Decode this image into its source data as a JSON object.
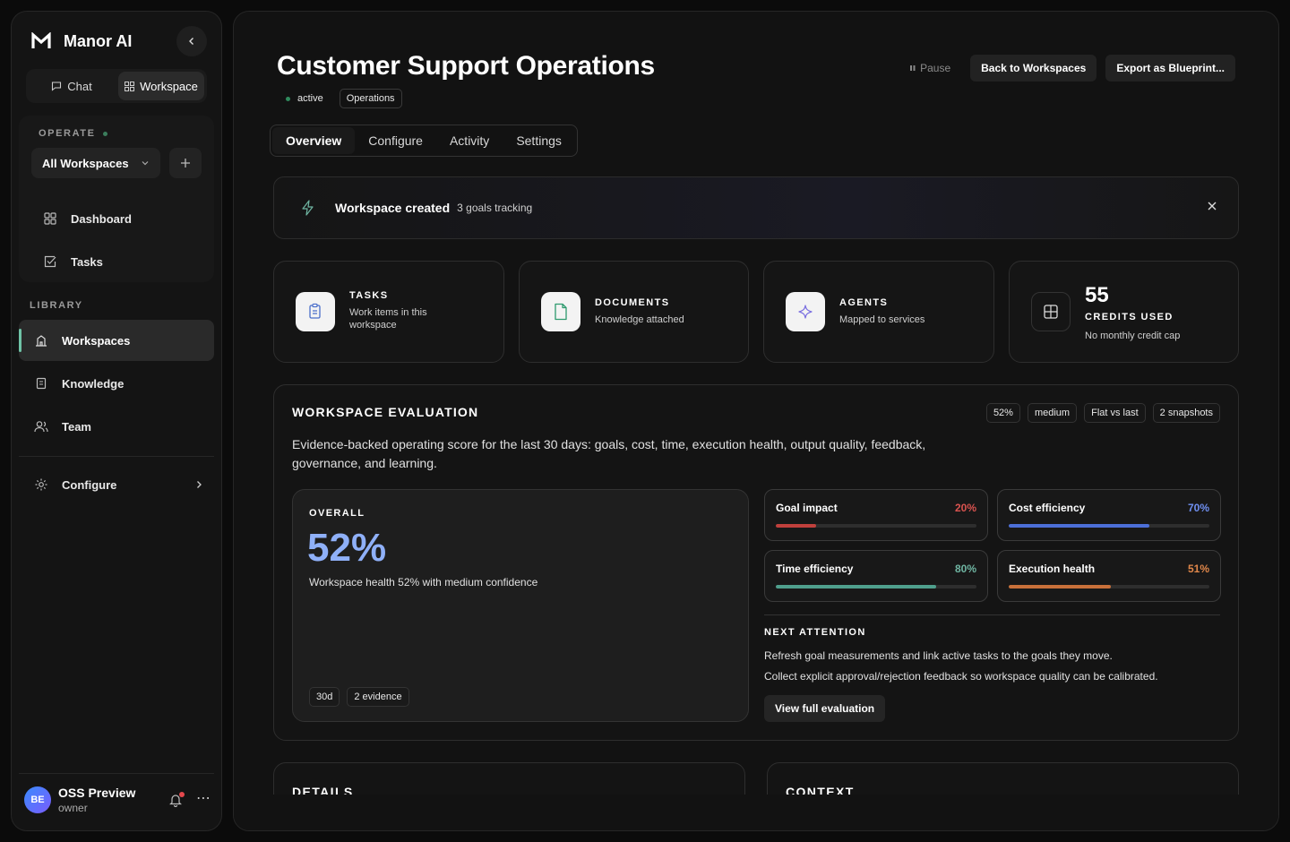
{
  "brand": {
    "name": "Manor AI"
  },
  "mode_switch": {
    "chat": "Chat",
    "workspace": "Workspace"
  },
  "sidebar": {
    "operate_label": "OPERATE",
    "workspace_select": "All Workspaces",
    "operate_items": [
      {
        "label": "Dashboard",
        "icon": "grid-icon"
      },
      {
        "label": "Tasks",
        "icon": "checkbox-icon"
      }
    ],
    "library_label": "LIBRARY",
    "library_items": [
      {
        "label": "Workspaces",
        "icon": "building-icon",
        "active": true
      },
      {
        "label": "Knowledge",
        "icon": "book-icon"
      },
      {
        "label": "Team",
        "icon": "users-icon"
      }
    ],
    "configure": "Configure"
  },
  "user": {
    "initials": "BE",
    "name": "OSS Preview",
    "role": "owner"
  },
  "header": {
    "title": "Customer Support Operations",
    "status": "active",
    "category_tag": "Operations",
    "pause": "Pause",
    "back": "Back to Workspaces",
    "export": "Export as Blueprint..."
  },
  "tabs": [
    "Overview",
    "Configure",
    "Activity",
    "Settings"
  ],
  "banner": {
    "title": "Workspace created",
    "subtitle": "3 goals tracking"
  },
  "stats": [
    {
      "title": "TASKS",
      "subtitle": "Work items in this workspace",
      "icon": "clipboard-icon"
    },
    {
      "title": "DOCUMENTS",
      "subtitle": "Knowledge attached",
      "icon": "document-icon"
    },
    {
      "title": "AGENTS",
      "subtitle": "Mapped to services",
      "icon": "sparkle-icon"
    },
    {
      "value": "55",
      "title": "CREDITS USED",
      "subtitle": "No monthly credit cap",
      "icon": "plus-box-icon"
    }
  ],
  "evaluation": {
    "title": "WORKSPACE EVALUATION",
    "chips": [
      "52%",
      "medium",
      "Flat vs last",
      "2 snapshots"
    ],
    "description": "Evidence-backed operating score for the last 30 days: goals, cost, time, execution health, output quality, feedback, governance, and learning.",
    "overall_label": "OVERALL",
    "overall_value": "52%",
    "overall_caption": "Workspace health 52% with medium confidence",
    "overall_chips": [
      "30d",
      "2 evidence"
    ],
    "metrics": [
      {
        "name": "Goal impact",
        "value_label": "20%",
        "value": 0.2,
        "color": "#d9534f",
        "track_color": "#c0403c"
      },
      {
        "name": "Cost efficiency",
        "value_label": "70%",
        "value": 0.7,
        "color": "#6f8ff0",
        "track_color": "#4c6fd8"
      },
      {
        "name": "Time efficiency",
        "value_label": "80%",
        "value": 0.8,
        "color": "#6fb5a2",
        "track_color": "#4f9f8c"
      },
      {
        "name": "Execution health",
        "value_label": "51%",
        "value": 0.51,
        "color": "#e0874a",
        "track_color": "#c8703a"
      }
    ],
    "next_label": "NEXT ATTENTION",
    "next_items": [
      "Refresh goal measurements and link active tasks to the goals they move.",
      "Collect explicit approval/rejection feedback so workspace quality can be calibrated."
    ],
    "view_button": "View full evaluation"
  },
  "bottom": {
    "details": "DETAILS",
    "context": "CONTEXT"
  }
}
